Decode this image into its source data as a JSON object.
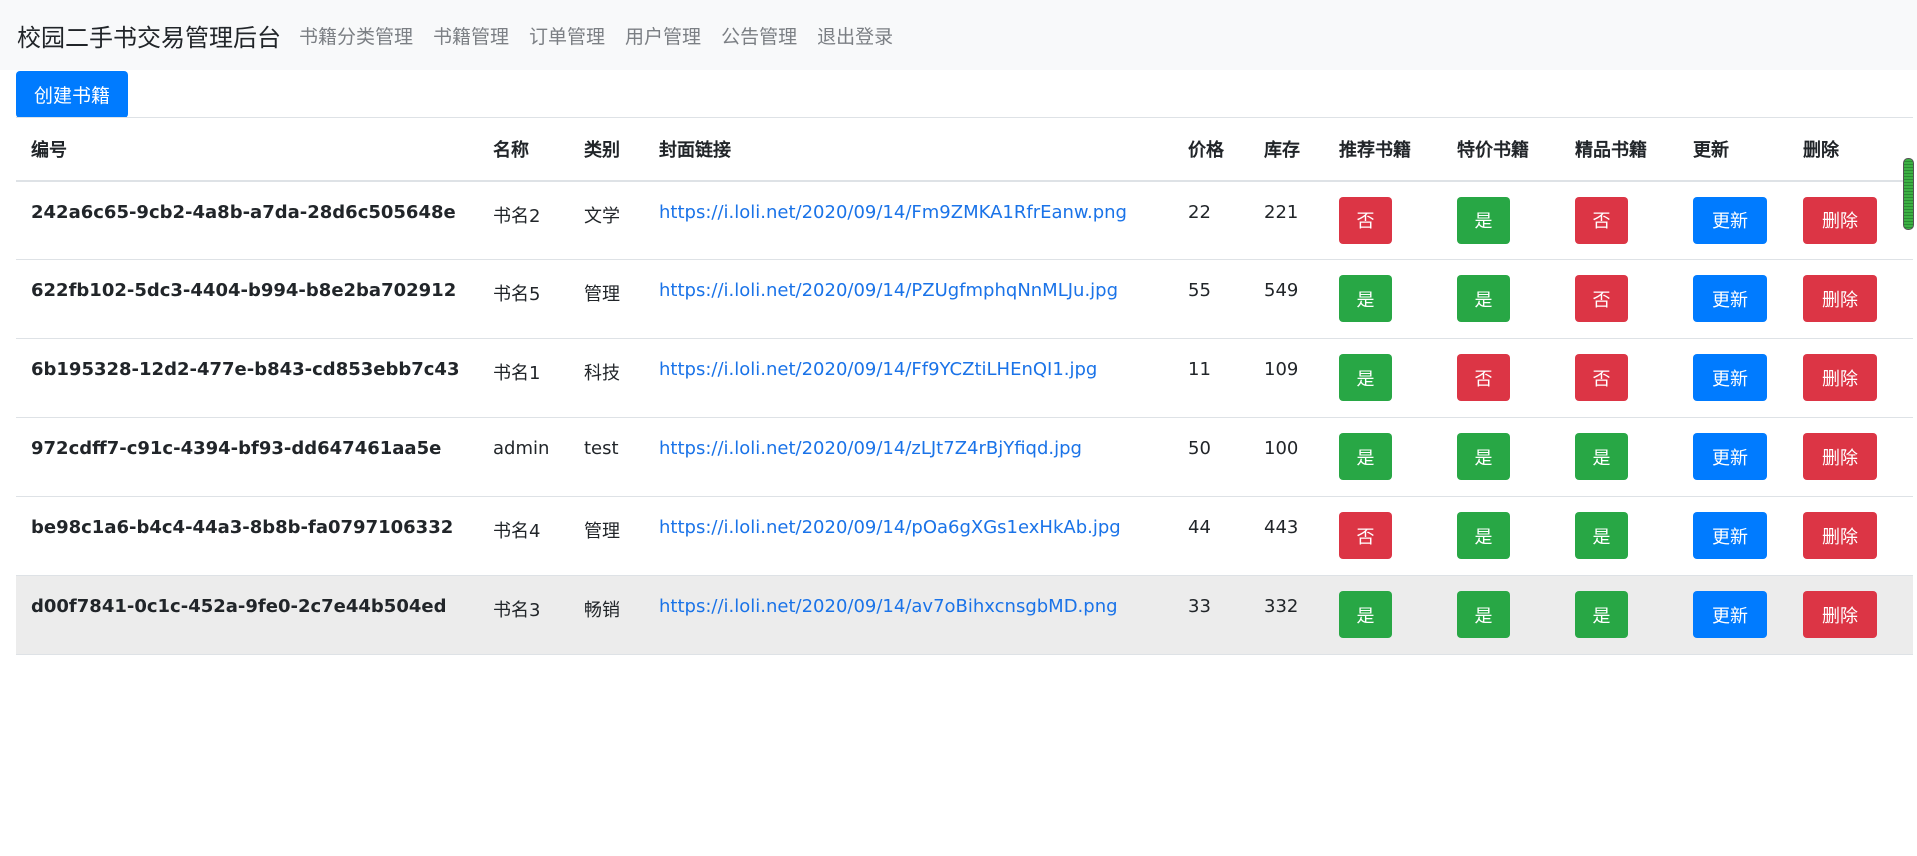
{
  "nav": {
    "brand": "校园二手书交易管理后台",
    "links": [
      "书籍分类管理",
      "书籍管理",
      "订单管理",
      "用户管理",
      "公告管理",
      "退出登录"
    ]
  },
  "create_button": "创建书籍",
  "table": {
    "headers": [
      "编号",
      "名称",
      "类别",
      "封面链接",
      "价格",
      "库存",
      "推荐书籍",
      "特价书籍",
      "精品书籍",
      "更新",
      "删除"
    ],
    "update_label": "更新",
    "delete_label": "删除",
    "rows": [
      {
        "id": "242a6c65-9cb2-4a8b-a7da-28d6c505648e",
        "name": "书名2",
        "category": "文学",
        "cover": "https://i.loli.net/2020/09/14/Fm9ZMKA1RfrEanw.png",
        "price": "22",
        "stock": "221",
        "recommend": "否",
        "special": "是",
        "premium": "否"
      },
      {
        "id": "622fb102-5dc3-4404-b994-b8e2ba702912",
        "name": "书名5",
        "category": "管理",
        "cover": "https://i.loli.net/2020/09/14/PZUgfmphqNnMLJu.jpg",
        "price": "55",
        "stock": "549",
        "recommend": "是",
        "special": "是",
        "premium": "否"
      },
      {
        "id": "6b195328-12d2-477e-b843-cd853ebb7c43",
        "name": "书名1",
        "category": "科技",
        "cover": "https://i.loli.net/2020/09/14/Ff9YCZtiLHEnQI1.jpg",
        "price": "11",
        "stock": "109",
        "recommend": "是",
        "special": "否",
        "premium": "否"
      },
      {
        "id": "972cdff7-c91c-4394-bf93-dd647461aa5e",
        "name": "admin",
        "category": "test",
        "cover": "https://i.loli.net/2020/09/14/zLJt7Z4rBjYfiqd.jpg",
        "price": "50",
        "stock": "100",
        "recommend": "是",
        "special": "是",
        "premium": "是"
      },
      {
        "id": "be98c1a6-b4c4-44a3-8b8b-fa0797106332",
        "name": "书名4",
        "category": "管理",
        "cover": "https://i.loli.net/2020/09/14/pOa6gXGs1exHkAb.jpg",
        "price": "44",
        "stock": "443",
        "recommend": "否",
        "special": "是",
        "premium": "是"
      },
      {
        "id": "d00f7841-0c1c-452a-9fe0-2c7e44b504ed",
        "name": "书名3",
        "category": "畅销",
        "cover": "https://i.loli.net/2020/09/14/av7oBihxcnsgbMD.png",
        "price": "33",
        "stock": "332",
        "recommend": "是",
        "special": "是",
        "premium": "是"
      }
    ]
  },
  "colors": {
    "primary": "#007bff",
    "success": "#28a745",
    "danger": "#dc3545",
    "link": "#1a73e8",
    "navbar_bg": "#f8f9fa"
  }
}
